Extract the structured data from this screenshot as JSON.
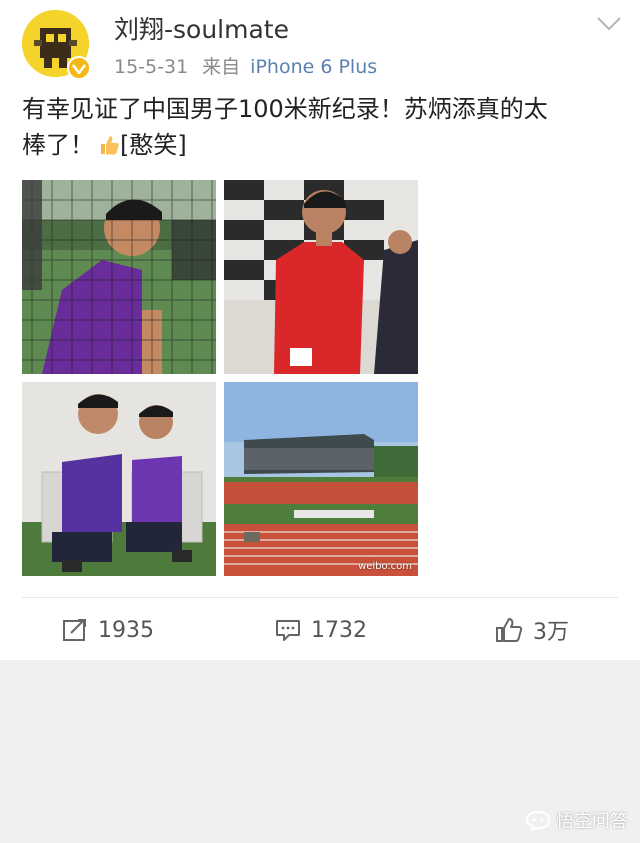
{
  "post": {
    "username": "刘翔-soulmate",
    "date": "15-5-31",
    "source_prefix": "来自",
    "source_device": "iPhone 6 Plus",
    "text_line1": "有幸见证了中国男子100米新纪录！苏炳添真的太",
    "text_line2_before": "棒了！",
    "text_line2_after": "[憨笑]"
  },
  "photos": {
    "photo4_watermark": "weibo.com"
  },
  "actions": {
    "repost_count": "1935",
    "comment_count": "1732",
    "like_count": "3万"
  },
  "footer": {
    "watermark": "悟空问答"
  },
  "icons": {
    "avatar": "avatar-image",
    "verified": "verified-badge-icon",
    "menu": "chevron-down-icon",
    "thumb": "thumbs-up-emoji-icon",
    "repost": "repost-icon",
    "comment": "comment-icon",
    "like": "like-icon"
  },
  "colors": {
    "link": "#5b80b2",
    "badge": "#f6b817",
    "background": "#f0f0f0"
  }
}
